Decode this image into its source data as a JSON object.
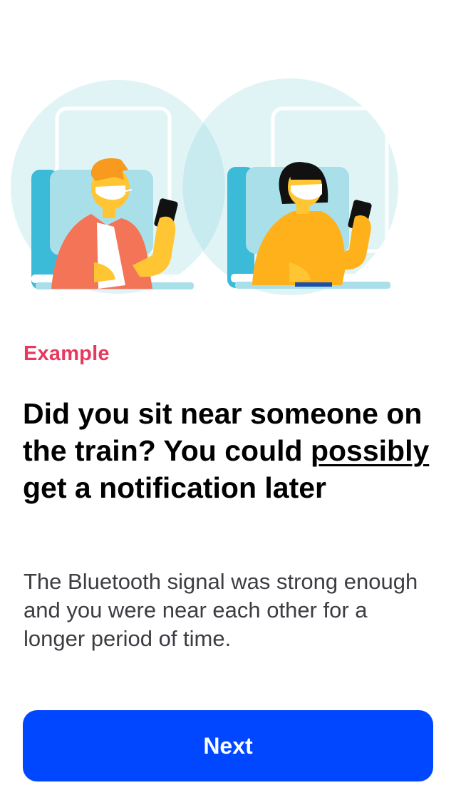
{
  "illustration": {
    "icon": "train-passengers-illustration",
    "colors": {
      "circle": "#e0f4f6",
      "overlap": "#c8ebef",
      "seat_dark": "#3bbbd8",
      "seat_light": "#a9dfe9",
      "jacket": "#f47458",
      "hair_man": "#f79a1d",
      "skin": "#ffc533",
      "sweater": "#ffb11b",
      "hair_woman": "#111111"
    }
  },
  "content": {
    "eyebrow": "Example",
    "headline_part1": "Did you sit near someone on the train? You could ",
    "headline_emphasis": "possibly",
    "headline_part2": " get a notification later",
    "body": "The Bluetooth signal was strong enough and you were near each other for a longer period of time."
  },
  "actions": {
    "next_label": "Next"
  },
  "colors": {
    "eyebrow": "#e8385e",
    "primary_button": "#0047ff",
    "body_text": "#3c3c43"
  }
}
